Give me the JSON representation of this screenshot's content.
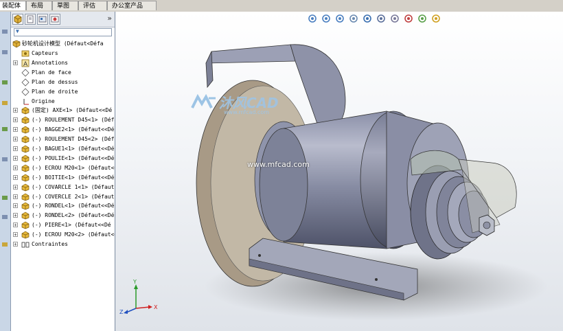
{
  "tabs": [
    {
      "label": "装配体",
      "active": true
    },
    {
      "label": "布局",
      "active": false
    },
    {
      "label": "草图",
      "active": false
    },
    {
      "label": "评估",
      "active": false
    },
    {
      "label": "办公室产品",
      "active": false
    }
  ],
  "panel": {
    "collapse_label": "»",
    "filter_symbol": "▼"
  },
  "tree": {
    "root": "砂轮机设计模型  (Défaut<Défa",
    "items": [
      {
        "label": "Capteurs",
        "icon": "sensor-icon"
      },
      {
        "label": "Annotations",
        "icon": "annotation-icon"
      },
      {
        "label": "Plan de face",
        "icon": "plane-icon"
      },
      {
        "label": "Plan de dessus",
        "icon": "plane-icon"
      },
      {
        "label": "Plan de droite",
        "icon": "plane-icon"
      },
      {
        "label": "Origine",
        "icon": "origin-icon"
      },
      {
        "label": "(固定) AXE<1> (Défaut<<Dé",
        "icon": "part-icon"
      },
      {
        "label": "(-) ROULEMENT D45<1> (Défa",
        "icon": "part-icon"
      },
      {
        "label": "(-) BAGGE2<1> (Défaut<<Dé",
        "icon": "part-icon"
      },
      {
        "label": "(-) ROULEMENT D45<2> (Défa",
        "icon": "part-icon"
      },
      {
        "label": "(-) BAGUE1<1> (Défaut<<Dé",
        "icon": "part-icon"
      },
      {
        "label": "(-) POULIE<1> (Défaut<<Dé",
        "icon": "part-icon"
      },
      {
        "label": "(-) ECROU M20<1> (Défaut<<",
        "icon": "part-icon"
      },
      {
        "label": "(-) BOITIE<1> (Défaut<<Dé",
        "icon": "part-icon"
      },
      {
        "label": "(-) COVARCLE 1<1> (Défaut",
        "icon": "part-icon"
      },
      {
        "label": "(-) COVERCLE 2<1> (Défaut",
        "icon": "part-icon"
      },
      {
        "label": "(-) RONDEL<1> (Défaut<<Dé",
        "icon": "part-icon"
      },
      {
        "label": "(-) RONDEL<2> (Défaut<<Dé",
        "icon": "part-icon"
      },
      {
        "label": "(-) PIERE<1> (Défaut<<Dé",
        "icon": "part-icon"
      },
      {
        "label": "(-) ECROU M20<2> (Défaut<<",
        "icon": "part-icon"
      },
      {
        "label": "Contraintes",
        "icon": "mates-icon"
      }
    ]
  },
  "watermark": {
    "brand": "沐风CAD",
    "site": "www.mfcad.com",
    "center_url": "www.mfcad.com"
  },
  "triad": {
    "x": "X",
    "y": "Y",
    "z": "Z"
  },
  "view_toolbar": [
    "zoom-to-fit-icon",
    "zoom-area-icon",
    "previous-view-icon",
    "section-view-icon",
    "view-orientation-icon",
    "display-style-icon",
    "hide-show-icon",
    "edit-appearance-icon",
    "apply-scene-icon",
    "view-settings-icon"
  ]
}
